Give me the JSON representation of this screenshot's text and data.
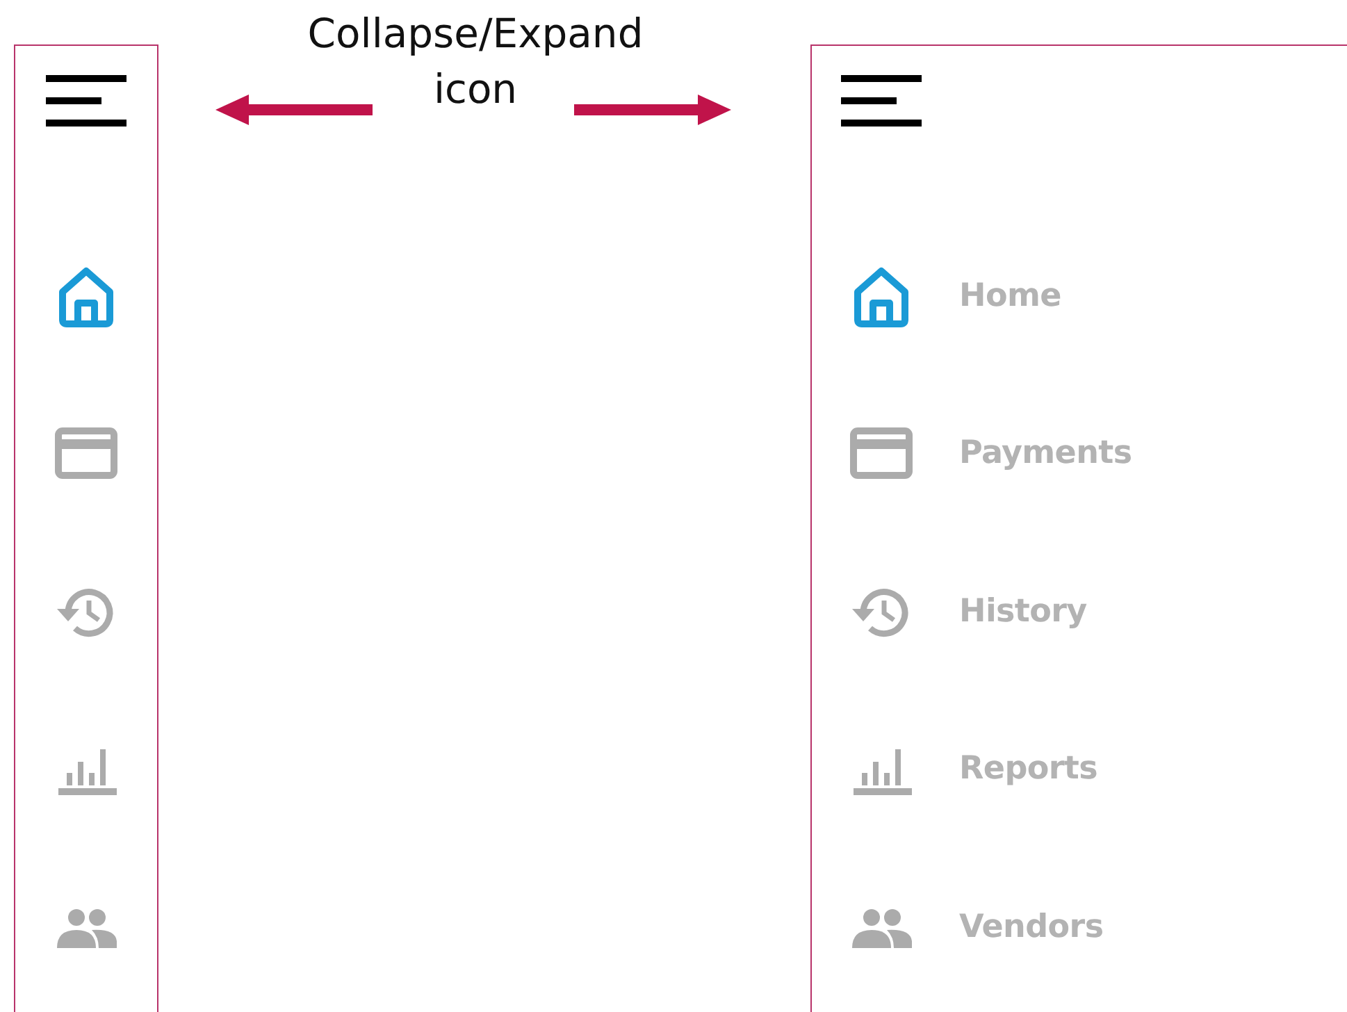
{
  "caption": {
    "lines": [
      "Collapse/Expand",
      "icon"
    ]
  },
  "collapsed_sidebar": {
    "items": [
      {
        "kind": "home",
        "selected": true
      },
      {
        "kind": "card",
        "selected": false
      },
      {
        "kind": "history",
        "selected": false
      },
      {
        "kind": "chart",
        "selected": false
      },
      {
        "kind": "people",
        "selected": false
      }
    ]
  },
  "expanded_sidebar": {
    "items": [
      {
        "kind": "home",
        "label": "Home",
        "selected": true
      },
      {
        "kind": "card",
        "label": "Payments",
        "selected": false
      },
      {
        "kind": "history",
        "label": "History",
        "selected": false
      },
      {
        "kind": "chart",
        "label": "Reports",
        "selected": false
      },
      {
        "kind": "people",
        "label": "Vendors",
        "selected": false
      }
    ]
  }
}
